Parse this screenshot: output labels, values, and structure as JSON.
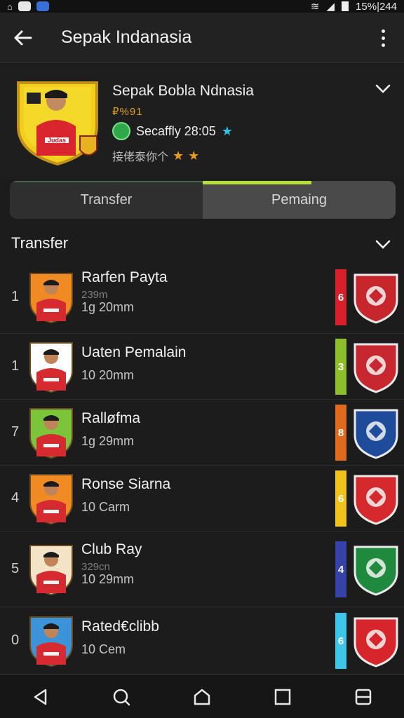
{
  "status_bar": {
    "battery_time": "15%|244"
  },
  "app_bar": {
    "title": "Sepak Indanasia"
  },
  "profile": {
    "name": "Sepak Bobla Ndnasia",
    "subtitle": "₽%91",
    "live_label": "Secaffly 28:05",
    "rating_label": "接佬泰你个",
    "crest_text": "Judas"
  },
  "tabs": [
    {
      "label": "Transfer",
      "active": false
    },
    {
      "label": "Pemaing",
      "active": true
    }
  ],
  "section": {
    "title": "Transfer"
  },
  "rows": [
    {
      "rank": "1",
      "name": "Rarfen Payta",
      "small": "239m",
      "meta": "1g 20mm",
      "bar_value": "6",
      "bar_color": "#d8202a",
      "avatar_bg": "#f08a22",
      "badge_color": "#c6262c"
    },
    {
      "rank": "1",
      "name": "Uaten Pemalain",
      "small": "",
      "meta": "10 20mm",
      "bar_value": "3",
      "bar_color": "#8cbf2a",
      "avatar_bg": "#ffffff",
      "badge_color": "#c7282f"
    },
    {
      "rank": "7",
      "name": "Ralløfma",
      "small": "",
      "meta": "1g 29mm",
      "bar_value": "8",
      "bar_color": "#e06a1c",
      "avatar_bg": "#7cc43a",
      "badge_color": "#1f4c9a"
    },
    {
      "rank": "4",
      "name": "Ronse Siarna",
      "small": "",
      "meta": "10 Carm",
      "bar_value": "6",
      "bar_color": "#f1c21a",
      "avatar_bg": "#f08a22",
      "badge_color": "#d52a2d"
    },
    {
      "rank": "5",
      "name": "Club Ray",
      "small": "329cn",
      "meta": "10 29mm",
      "bar_value": "4",
      "bar_color": "#3542a8",
      "avatar_bg": "#f3e4c7",
      "badge_color": "#1f8a3d"
    },
    {
      "rank": "0",
      "name": "Rated€clibb",
      "small": "",
      "meta": "10 Cem",
      "bar_value": "6",
      "bar_color": "#3dc6e8",
      "avatar_bg": "#3c93d8",
      "badge_color": "#d7262b"
    }
  ]
}
